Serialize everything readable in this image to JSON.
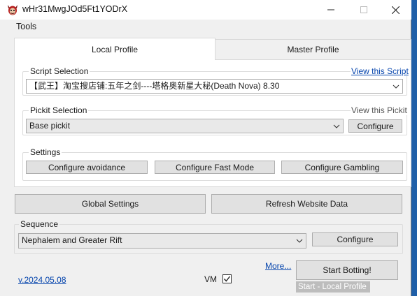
{
  "window": {
    "title": "wHr31MwgJOd5Ft1YODrX",
    "icon": "devil-face-icon"
  },
  "menu": {
    "tools": "Tools"
  },
  "tabs": [
    {
      "label": "Local Profile",
      "selected": true
    },
    {
      "label": "Master Profile",
      "selected": false
    }
  ],
  "script_selection": {
    "label": "Script Selection",
    "view_link": "View this Script",
    "selected": "【武王】淘宝搜店铺:五年之剑----塔格奥新星大秘(Death Nova)    8.30"
  },
  "pickit_selection": {
    "label": "Pickit Selection",
    "view_label": "View this Pickit",
    "selected": "Base pickit",
    "configure": "Configure"
  },
  "settings": {
    "label": "Settings",
    "buttons": [
      "Configure avoidance",
      "Configure Fast Mode",
      "Configure Gambling"
    ]
  },
  "global_settings_button": "Global Settings",
  "refresh_button": "Refresh Website Data",
  "sequence": {
    "label": "Sequence",
    "selected": "Nephalem and Greater Rift",
    "configure": "Configure"
  },
  "footer": {
    "version": "v.2024.05.08",
    "vm_label": "VM",
    "vm_checked": true,
    "more_link": "More...",
    "start_button": "Start Botting!",
    "status": "Start - Local Profile"
  },
  "colors": {
    "link": "#0645ad",
    "desktop": "#1f5fa8",
    "status_bg": "#bdbdbd"
  }
}
